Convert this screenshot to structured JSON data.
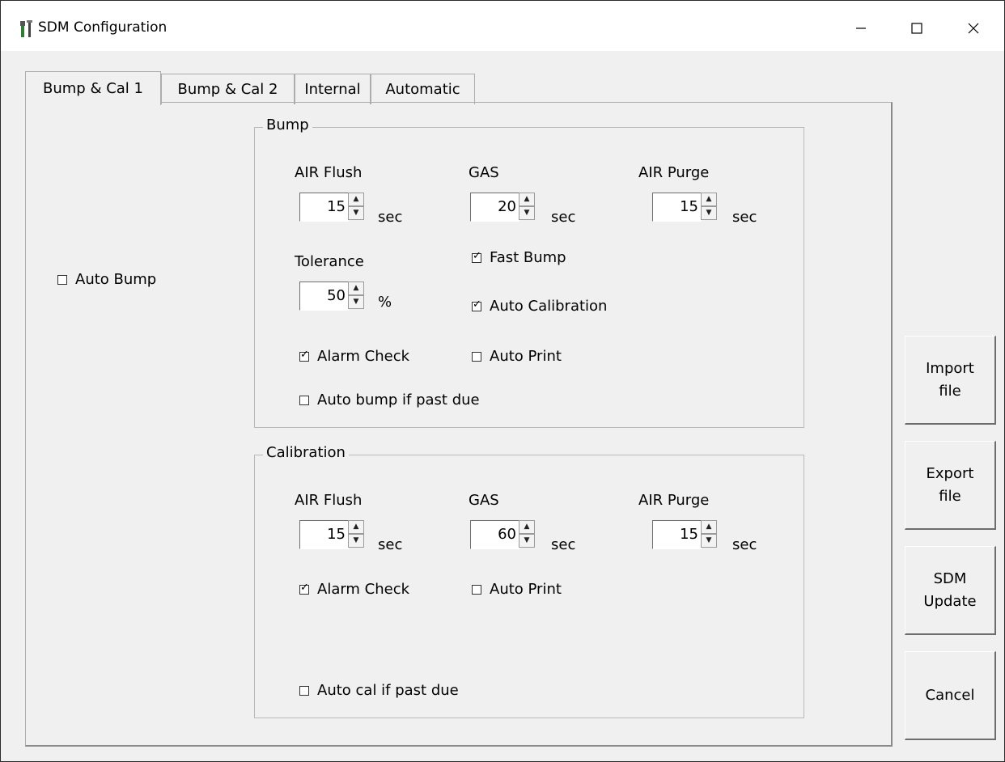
{
  "window": {
    "title": "SDM Configuration"
  },
  "tabs": [
    {
      "label": "Bump & Cal 1"
    },
    {
      "label": "Bump & Cal 2"
    },
    {
      "label": "Internal"
    },
    {
      "label": "Automatic"
    }
  ],
  "auto_bump": {
    "label": "Auto Bump",
    "checked": false
  },
  "bump": {
    "title": "Bump",
    "air_flush": {
      "label": "AIR Flush",
      "value": "15",
      "unit": "sec"
    },
    "gas": {
      "label": "GAS",
      "value": "20",
      "unit": "sec"
    },
    "air_purge": {
      "label": "AIR Purge",
      "value": "15",
      "unit": "sec"
    },
    "tolerance": {
      "label": "Tolerance",
      "value": "50",
      "unit": "%"
    },
    "fast_bump": {
      "label": "Fast Bump",
      "checked": true
    },
    "auto_calibration": {
      "label": "Auto Calibration",
      "checked": true
    },
    "alarm_check": {
      "label": "Alarm Check",
      "checked": true
    },
    "auto_print": {
      "label": "Auto Print",
      "checked": false
    },
    "auto_bump_past_due": {
      "label": "Auto bump if past due",
      "checked": false
    }
  },
  "calibration": {
    "title": "Calibration",
    "air_flush": {
      "label": "AIR Flush",
      "value": "15",
      "unit": "sec"
    },
    "gas": {
      "label": "GAS",
      "value": "60",
      "unit": "sec"
    },
    "air_purge": {
      "label": "AIR Purge",
      "value": "15",
      "unit": "sec"
    },
    "alarm_check": {
      "label": "Alarm Check",
      "checked": true
    },
    "auto_print": {
      "label": "Auto Print",
      "checked": false
    },
    "auto_cal_past_due": {
      "label": "Auto cal if past due",
      "checked": false
    }
  },
  "side_buttons": {
    "import": "Import\nfile",
    "export": "Export\nfile",
    "sdm_update": "SDM\nUpdate",
    "cancel": "Cancel"
  },
  "icons": {
    "app": "tools-icon",
    "minimize": "minimize-icon",
    "maximize": "maximize-icon",
    "close": "close-icon"
  }
}
